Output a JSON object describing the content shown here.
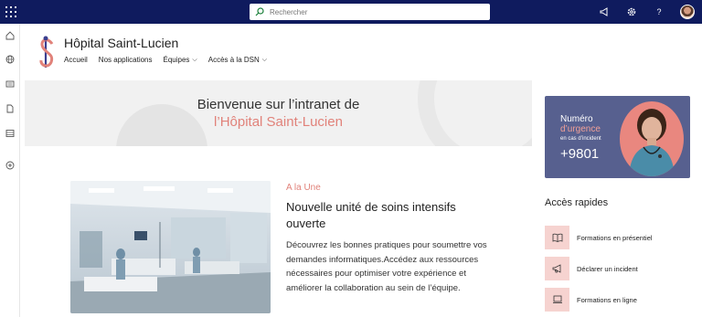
{
  "topbar": {
    "search_placeholder": "Rechercher"
  },
  "site": {
    "title": "Hôpital Saint-Lucien",
    "nav": [
      {
        "label": "Accueil",
        "has_dropdown": false
      },
      {
        "label": "Nos applications",
        "has_dropdown": false
      },
      {
        "label": "Équipes",
        "has_dropdown": true
      },
      {
        "label": "Accès à la DSN",
        "has_dropdown": true
      }
    ]
  },
  "hero": {
    "line1": "Bienvenue sur l’intranet de",
    "line2": "l’Hôpital Saint-Lucien"
  },
  "news": {
    "kicker": "A la Une",
    "title": "Nouvelle unité de soins intensifs ouverte",
    "body": "Découvrez les bonnes pratiques pour soumettre vos demandes informatiques.Accédez aux ressources nécessaires pour optimiser votre expérience et améliorer la collaboration au sein de l’équipe."
  },
  "emergency": {
    "line1": "Numéro",
    "line2": "d’urgence",
    "line3": "en cas d’incident",
    "number": "+9801"
  },
  "quick_access": {
    "title": "Accès rapides",
    "items": [
      {
        "label": "Formations en présentiel",
        "icon": "book-icon"
      },
      {
        "label": "Déclarer un incident",
        "icon": "megaphone-icon"
      },
      {
        "label": "Formations en ligne",
        "icon": "laptop-icon"
      }
    ]
  },
  "colors": {
    "suitebar": "#0f1b5e",
    "accent": "#e1827a",
    "emergency_bg": "#57608f",
    "quick_tile": "#f6d3d0"
  }
}
